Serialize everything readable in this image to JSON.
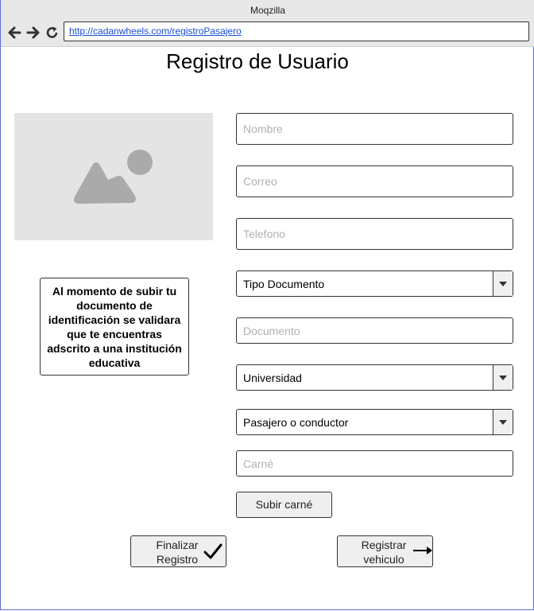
{
  "browser": {
    "title": "Moqzilla",
    "url": " http://cadanwheels.com/registroPasajero",
    "icons": [
      "back-arrow-icon",
      "forward-arrow-icon",
      "reload-icon"
    ]
  },
  "page": {
    "title": "Registro de Usuario",
    "image_placeholder_icon": "image-icon",
    "info_text": "Al momento de subir tu documento de identificación se validara que te encuentras adscrito a una institución educativa"
  },
  "form": {
    "nombre_placeholder": "Nombre",
    "correo_placeholder": "Correo",
    "telefono_placeholder": "Telefono",
    "tipo_documento": "Tipo Documento",
    "documento_placeholder": "Documento",
    "universidad": "Universidad",
    "rol": "Pasajero o conductor",
    "carne_placeholder": "Carné",
    "upload_button": "Subir carné"
  },
  "actions": {
    "finalizar_line1": "Finalizar",
    "finalizar_line2": "Registro",
    "registrar_line1": "Registrar",
    "registrar_line2": "vehiculo",
    "finalizar_icon": "checkmark-icon",
    "registrar_icon": "arrow-right-icon"
  }
}
